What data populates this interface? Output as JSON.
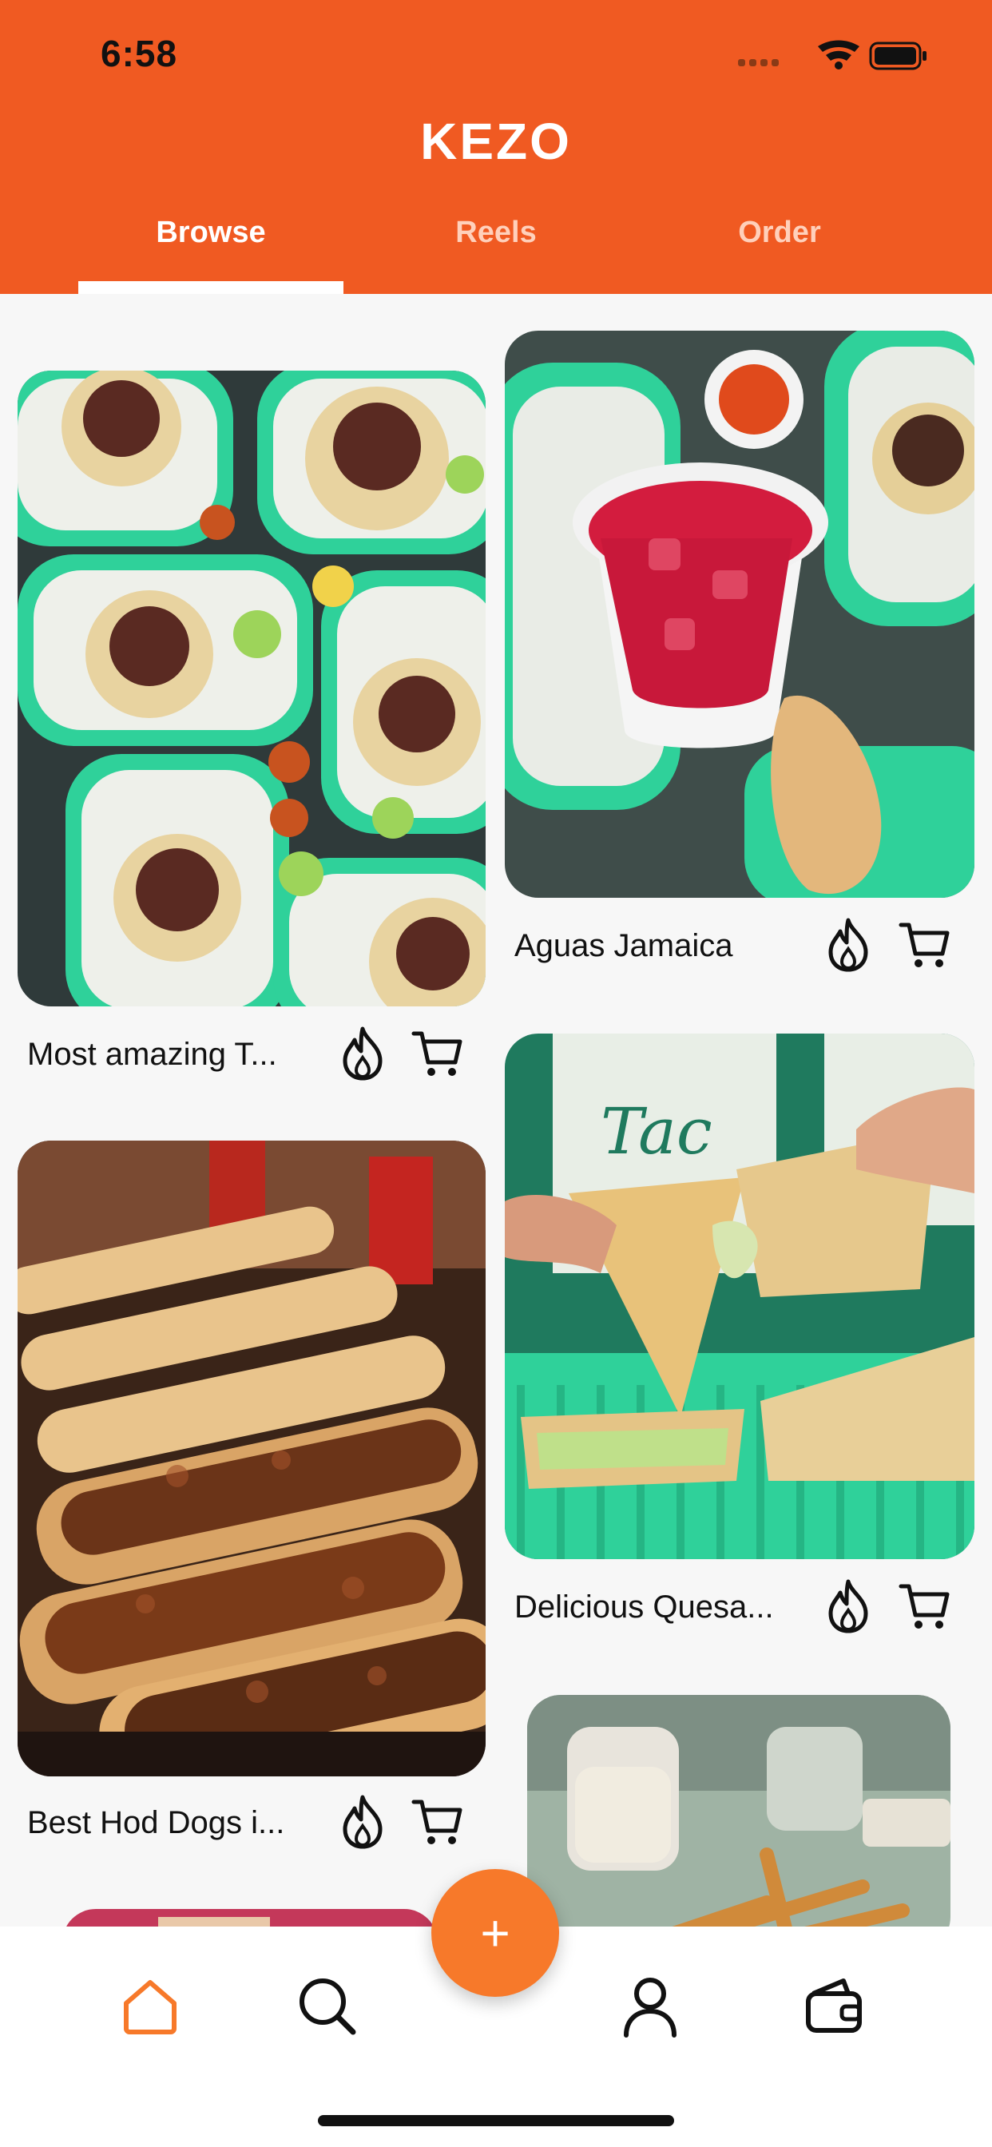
{
  "status_bar": {
    "time": "6:58"
  },
  "app": {
    "logo": "KEZO",
    "brand_color": "#f05a22",
    "accent_color": "#f7792a"
  },
  "tabs": [
    {
      "label": "Browse",
      "active": true
    },
    {
      "label": "Reels",
      "active": false
    },
    {
      "label": "Order",
      "active": false
    }
  ],
  "feed": [
    {
      "title": "Most amazing T...",
      "image": "tacos-on-green-baskets",
      "actions": [
        "flame-icon",
        "cart-icon"
      ]
    },
    {
      "title": "Aguas Jamaica",
      "image": "red-drink-cup",
      "actions": [
        "flame-icon",
        "cart-icon"
      ]
    },
    {
      "title": "Best Hod Dogs i...",
      "image": "hot-dogs-tray",
      "actions": [
        "flame-icon",
        "cart-icon"
      ]
    },
    {
      "title": "Delicious Quesa...",
      "image": "quesadilla-pull",
      "actions": [
        "flame-icon",
        "cart-icon"
      ]
    },
    {
      "title": "",
      "image": "fries-and-sauce",
      "actions": []
    }
  ],
  "fab": {
    "label": "+"
  },
  "bottom_nav": [
    {
      "icon": "home-icon",
      "active": true
    },
    {
      "icon": "search-icon",
      "active": false
    },
    {
      "icon": "profile-icon",
      "active": false
    },
    {
      "icon": "wallet-icon",
      "active": false
    }
  ]
}
